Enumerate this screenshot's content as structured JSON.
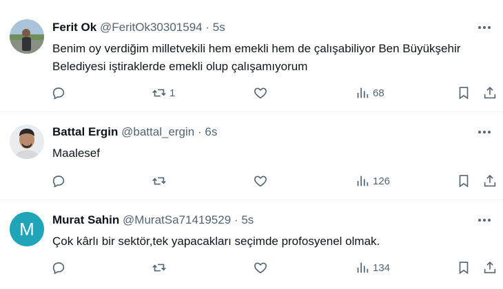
{
  "tweets": [
    {
      "name": "Ferit Ok",
      "handle": "@FeritOk30301594",
      "separator": "·",
      "time": "5s",
      "text": "Benim oy verdiğim milletvekili hem emekli hem de çalışabiliyor Ben Büyükşehir Belediyesi iştiraklerde emekli olup çalışamıyorum",
      "retweets": "1",
      "replies": "",
      "likes": "",
      "views": "68"
    },
    {
      "name": "Battal Ergin",
      "handle": "@battal_ergin",
      "separator": "·",
      "time": "6s",
      "text": "Maalesef",
      "retweets": "",
      "replies": "",
      "likes": "",
      "views": "126"
    },
    {
      "name": "Murat Sahin",
      "handle": "@MuratSa71419529",
      "separator": "·",
      "time": "5s",
      "avatar_letter": "M",
      "text": "Çok kârlı bir sektör,tek yapacakları seçimde profosyenel olmak.",
      "retweets": "",
      "replies": "",
      "likes": "",
      "views": "134"
    }
  ],
  "icons": {
    "reply": "reply-icon",
    "retweet": "retweet-icon",
    "like": "heart-icon",
    "views": "views-icon",
    "bookmark": "bookmark-icon",
    "share": "share-icon",
    "more": "more-icon"
  },
  "colors": {
    "text": "#0f1419",
    "secondary": "#536471",
    "divider": "#eff3f4",
    "letter_avatar": "#1fa4b8"
  }
}
